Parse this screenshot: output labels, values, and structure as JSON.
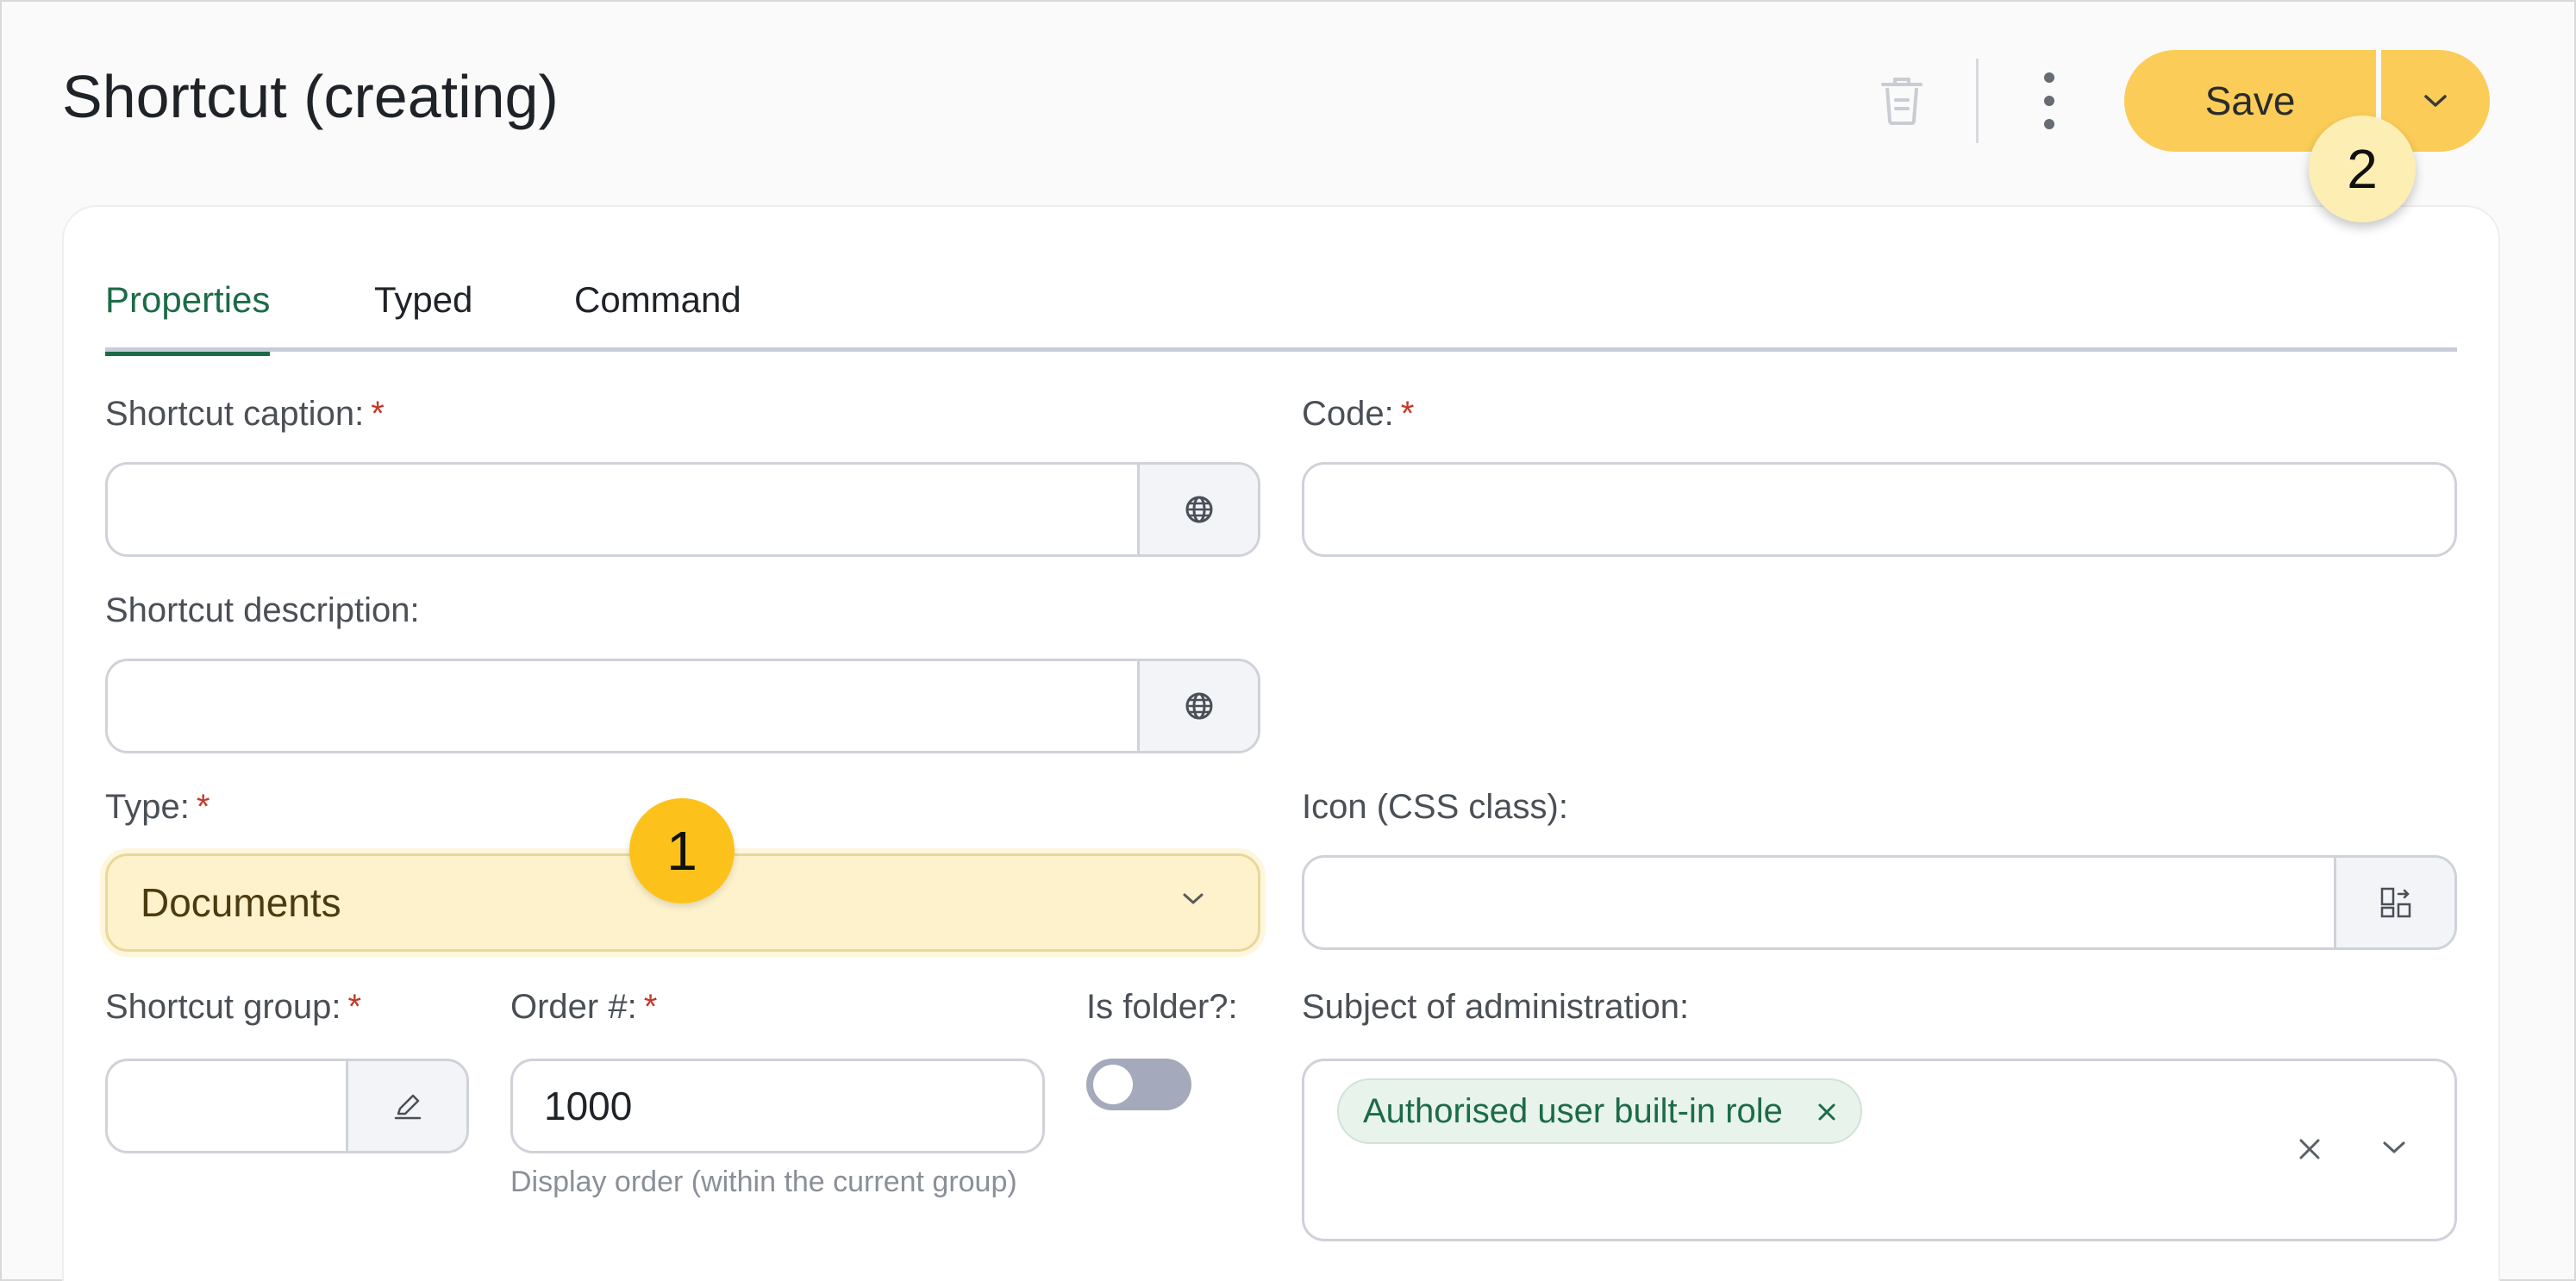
{
  "header": {
    "title": "Shortcut (creating)",
    "save_label": "Save"
  },
  "markers": {
    "one": "1",
    "two": "2"
  },
  "tabs": [
    {
      "label": "Properties",
      "active": true
    },
    {
      "label": "Typed",
      "active": false
    },
    {
      "label": "Command",
      "active": false
    }
  ],
  "form": {
    "caption_label": "Shortcut caption:",
    "caption_value": "",
    "code_label": "Code:",
    "code_value": "",
    "description_label": "Shortcut description:",
    "description_value": "",
    "type_label": "Type:",
    "type_value": "Documents",
    "icon_label": "Icon (CSS class):",
    "icon_value": "",
    "group_label": "Shortcut group:",
    "group_value": "",
    "order_label": "Order #:",
    "order_value": "1000",
    "order_hint": "Display order (within the current group)",
    "folder_label": "Is folder?:",
    "folder_on": false,
    "subject_label": "Subject of administration:",
    "subject_chips": [
      "Authorised user built-in role"
    ],
    "required_mark": "*"
  },
  "colors": {
    "accent": "#1c6b47",
    "save": "#fbcd58",
    "required": "#c0392b",
    "highlight": "#fef2cc"
  },
  "icons": {
    "trash": "trash-icon",
    "more": "more-vertical-icon",
    "dropdown": "chevron-down-icon",
    "globe": "globe-icon",
    "icon_picker": "icon-picker-icon",
    "edit": "pencil-icon",
    "close": "close-icon"
  }
}
